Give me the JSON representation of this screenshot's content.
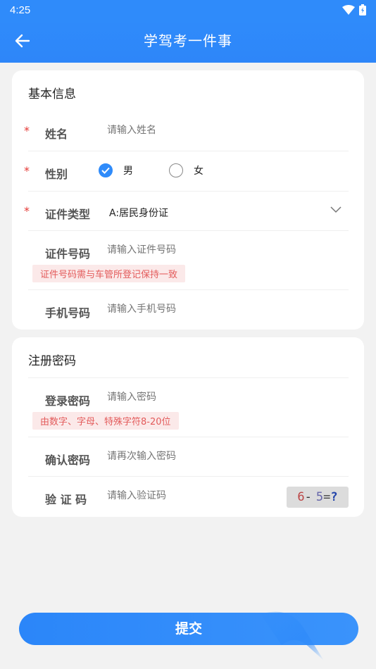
{
  "status_bar": {
    "time": "4:25"
  },
  "header": {
    "title": "学驾考一件事"
  },
  "basic_info": {
    "title": "基本信息",
    "name": {
      "label": "姓名",
      "placeholder": "请输入姓名"
    },
    "gender": {
      "label": "性别",
      "options": [
        "男",
        "女"
      ],
      "selected": "男"
    },
    "id_type": {
      "label": "证件类型",
      "value": "A:居民身份证"
    },
    "id_number": {
      "label": "证件号码",
      "placeholder": "请输入证件号码",
      "hint": "证件号码需与车管所登记保持一致"
    },
    "phone": {
      "label": "手机号码",
      "placeholder": "请输入手机号码"
    }
  },
  "register_password": {
    "title": "注册密码",
    "password": {
      "label": "登录密码",
      "placeholder": "请输入密码",
      "hint": "由数字、字母、特殊字符8-20位"
    },
    "confirm": {
      "label": "确认密码",
      "placeholder": "请再次输入密码"
    },
    "captcha": {
      "label": "验 证 码",
      "placeholder": "请输入验证码",
      "image_text": [
        "6",
        "-",
        "5",
        "=",
        "?"
      ]
    }
  },
  "submit_label": "提交",
  "colors": {
    "primary": "#2f8bfa",
    "required": "#e53935",
    "hint_text": "#e35b5b",
    "hint_bg": "#fbe9e9"
  }
}
